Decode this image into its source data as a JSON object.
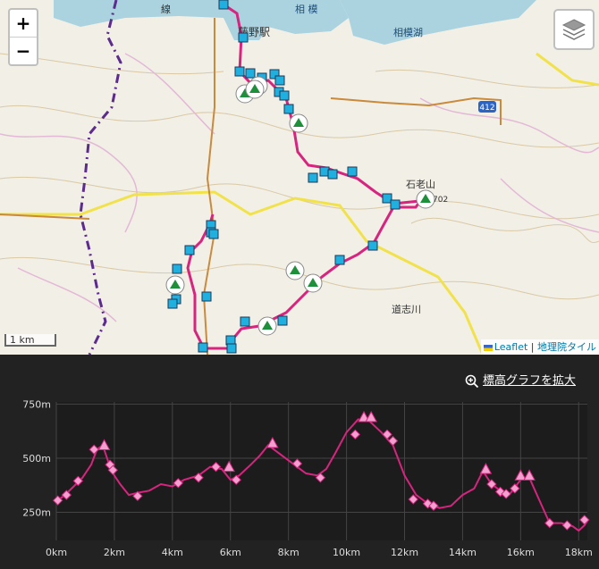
{
  "map": {
    "zoom_in": "+",
    "zoom_out": "−",
    "layers_icon": "layers-icon",
    "scale_label": "1 km",
    "attribution_leaflet": "Leaflet",
    "attribution_sep": "|",
    "attribution_gsi": "地理院タイル",
    "labels": {
      "station": "藤野駅",
      "lake": "相模湖",
      "line": "線",
      "mountain": "石老山",
      "route_no": "412",
      "river": "道志川",
      "peak_num": "702"
    }
  },
  "graph": {
    "expand_label": "標高グラフを拡大",
    "expand_icon": "zoom-in-icon"
  },
  "chart_data": {
    "type": "line",
    "title": "",
    "xlabel": "",
    "ylabel": "",
    "xlim": [
      0,
      18.3
    ],
    "ylim": [
      120,
      760
    ],
    "yticks": [
      250,
      500,
      750
    ],
    "ytick_labels": [
      "250m",
      "500m",
      "750m"
    ],
    "xticks": [
      0,
      2,
      4,
      6,
      8,
      10,
      12,
      14,
      16,
      18
    ],
    "xtick_labels": [
      "0km",
      "2km",
      "4km",
      "6km",
      "8km",
      "10km",
      "12km",
      "14km",
      "16km",
      "18km"
    ],
    "grid": true,
    "line_color": "#d6247f",
    "profile": [
      [
        0,
        300
      ],
      [
        0.3,
        330
      ],
      [
        0.6,
        370
      ],
      [
        0.9,
        410
      ],
      [
        1.2,
        470
      ],
      [
        1.4,
        540
      ],
      [
        1.6,
        560
      ],
      [
        1.8,
        480
      ],
      [
        2.0,
        420
      ],
      [
        2.2,
        380
      ],
      [
        2.5,
        330
      ],
      [
        2.8,
        340
      ],
      [
        3.2,
        350
      ],
      [
        3.6,
        380
      ],
      [
        4.0,
        370
      ],
      [
        4.4,
        400
      ],
      [
        4.9,
        420
      ],
      [
        5.3,
        460
      ],
      [
        5.7,
        450
      ],
      [
        6.0,
        400
      ],
      [
        6.3,
        420
      ],
      [
        6.7,
        470
      ],
      [
        7.0,
        510
      ],
      [
        7.3,
        560
      ],
      [
        7.6,
        530
      ],
      [
        8.0,
        490
      ],
      [
        8.3,
        460
      ],
      [
        8.6,
        430
      ],
      [
        9.0,
        420
      ],
      [
        9.3,
        450
      ],
      [
        9.6,
        520
      ],
      [
        10.0,
        620
      ],
      [
        10.4,
        680
      ],
      [
        10.8,
        670
      ],
      [
        11.2,
        620
      ],
      [
        11.6,
        560
      ],
      [
        12.0,
        420
      ],
      [
        12.4,
        330
      ],
      [
        12.8,
        290
      ],
      [
        13.2,
        270
      ],
      [
        13.6,
        280
      ],
      [
        14.0,
        330
      ],
      [
        14.4,
        360
      ],
      [
        14.7,
        440
      ],
      [
        15.0,
        380
      ],
      [
        15.3,
        350
      ],
      [
        15.6,
        330
      ],
      [
        16.0,
        400
      ],
      [
        16.3,
        410
      ],
      [
        16.6,
        320
      ],
      [
        17.0,
        200
      ],
      [
        17.4,
        200
      ],
      [
        17.8,
        185
      ],
      [
        18.0,
        165
      ],
      [
        18.2,
        190
      ],
      [
        18.3,
        210
      ]
    ],
    "points": [
      {
        "x": 0.05,
        "y": 305,
        "shape": "diamond"
      },
      {
        "x": 0.35,
        "y": 330,
        "shape": "diamond"
      },
      {
        "x": 0.75,
        "y": 395,
        "shape": "diamond"
      },
      {
        "x": 1.3,
        "y": 540,
        "shape": "diamond"
      },
      {
        "x": 1.65,
        "y": 560,
        "shape": "triangle"
      },
      {
        "x": 1.85,
        "y": 470,
        "shape": "diamond"
      },
      {
        "x": 1.95,
        "y": 445,
        "shape": "diamond"
      },
      {
        "x": 2.8,
        "y": 325,
        "shape": "diamond"
      },
      {
        "x": 4.2,
        "y": 385,
        "shape": "diamond"
      },
      {
        "x": 4.9,
        "y": 410,
        "shape": "diamond"
      },
      {
        "x": 5.5,
        "y": 460,
        "shape": "diamond"
      },
      {
        "x": 5.95,
        "y": 460,
        "shape": "triangle"
      },
      {
        "x": 6.2,
        "y": 400,
        "shape": "diamond"
      },
      {
        "x": 7.45,
        "y": 570,
        "shape": "triangle"
      },
      {
        "x": 8.3,
        "y": 475,
        "shape": "diamond"
      },
      {
        "x": 9.1,
        "y": 410,
        "shape": "diamond"
      },
      {
        "x": 10.3,
        "y": 610,
        "shape": "diamond"
      },
      {
        "x": 10.6,
        "y": 690,
        "shape": "triangle"
      },
      {
        "x": 10.85,
        "y": 690,
        "shape": "triangle"
      },
      {
        "x": 11.4,
        "y": 610,
        "shape": "diamond"
      },
      {
        "x": 11.6,
        "y": 580,
        "shape": "diamond"
      },
      {
        "x": 12.3,
        "y": 310,
        "shape": "diamond"
      },
      {
        "x": 12.8,
        "y": 290,
        "shape": "diamond"
      },
      {
        "x": 13.0,
        "y": 280,
        "shape": "diamond"
      },
      {
        "x": 14.8,
        "y": 450,
        "shape": "triangle"
      },
      {
        "x": 15.0,
        "y": 380,
        "shape": "diamond"
      },
      {
        "x": 15.3,
        "y": 345,
        "shape": "diamond"
      },
      {
        "x": 15.5,
        "y": 335,
        "shape": "diamond"
      },
      {
        "x": 15.8,
        "y": 360,
        "shape": "diamond"
      },
      {
        "x": 16.0,
        "y": 420,
        "shape": "triangle"
      },
      {
        "x": 16.3,
        "y": 420,
        "shape": "triangle"
      },
      {
        "x": 17.0,
        "y": 200,
        "shape": "diamond"
      },
      {
        "x": 17.6,
        "y": 190,
        "shape": "diamond"
      },
      {
        "x": 18.2,
        "y": 215,
        "shape": "diamond"
      }
    ]
  }
}
